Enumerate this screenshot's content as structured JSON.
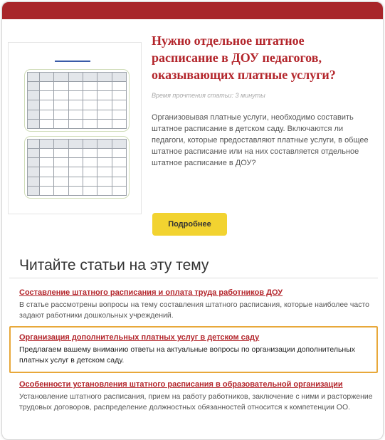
{
  "card": {
    "title": "Нужно отдельное штатное расписание в ДОУ педагогов, оказывающих платные услуги?",
    "read_time": "Время прочтения статьи: 3 минуты",
    "description": "Организовывая платные услуги, необходимо составить штатное расписание в детском саду. Включаются ли педагоги, которые предоставляют платные услуги, в общее штатное расписание или на них составляется отдельное штатное расписание в ДОУ?",
    "button_label": "Подробнее"
  },
  "related": {
    "heading": "Читайте статьи на эту тему",
    "articles": [
      {
        "title": "Составление штатного расписания и оплата труда работников ДОУ",
        "description": "В статье рассмотрены вопросы на тему составления штатного расписания, которые наиболее часто задают работники дошкольных учреждений."
      },
      {
        "title": "Организация дополнительных платных услуг в детском саду",
        "description": "Предлагаем вашему вниманию ответы на актуальные вопросы по организации дополнительных платных услуг в детском саду."
      },
      {
        "title": "Особенности установления штатного расписания в образовательной организации",
        "description": "Установление штатного расписания, прием на работу работников, заключение с ними и расторжение трудовых договоров, распределение должностных обязанностей относится к компетенции ОО."
      }
    ]
  },
  "colors": {
    "brand_red": "#a8262a",
    "link_red": "#b3252b",
    "button_yellow": "#f2d330",
    "highlight_orange": "#e8a83a"
  }
}
